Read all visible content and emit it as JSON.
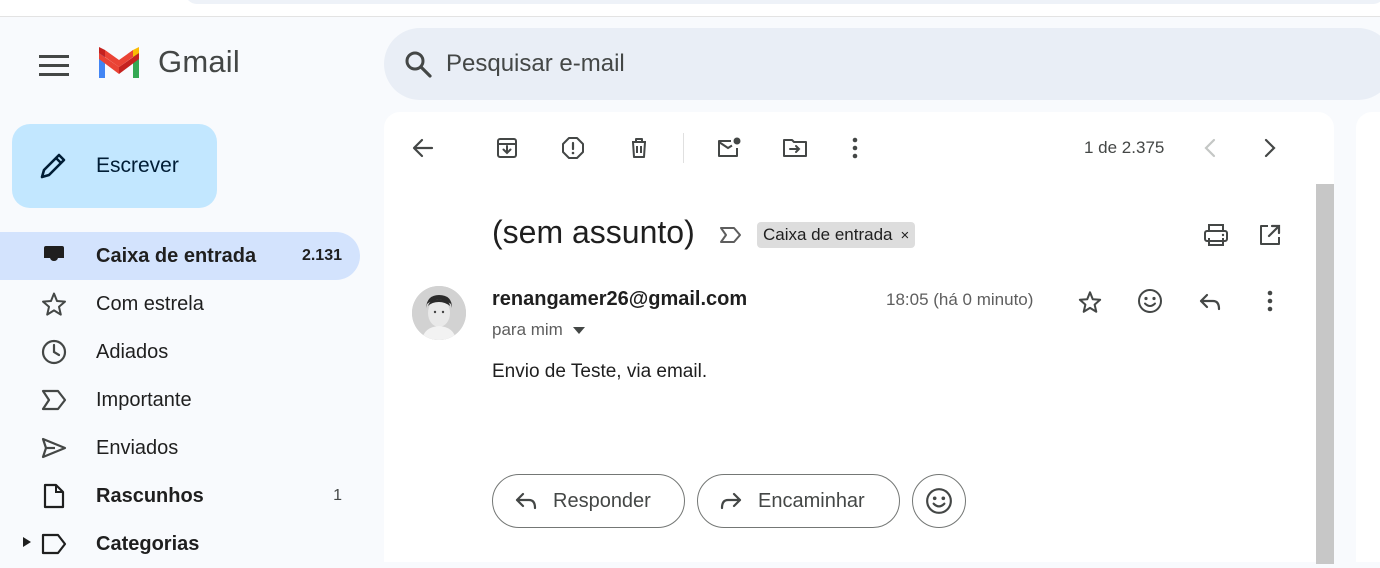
{
  "app": {
    "name": "Gmail"
  },
  "search": {
    "placeholder": "Pesquisar e-mail"
  },
  "compose": {
    "label": "Escrever"
  },
  "sidebar": {
    "items": [
      {
        "label": "Caixa de entrada",
        "count": "2.131",
        "icon": "inbox-icon",
        "active": true
      },
      {
        "label": "Com estrela",
        "count": "",
        "icon": "star-icon"
      },
      {
        "label": "Adiados",
        "count": "",
        "icon": "clock-icon"
      },
      {
        "label": "Importante",
        "count": "",
        "icon": "important-icon"
      },
      {
        "label": "Enviados",
        "count": "",
        "icon": "send-icon"
      },
      {
        "label": "Rascunhos",
        "count": "1",
        "icon": "draft-icon",
        "bold": true
      },
      {
        "label": "Categorias",
        "count": "",
        "icon": "label-icon",
        "bold": true
      }
    ]
  },
  "toolbar": {
    "buttons": [
      "back-icon",
      "archive-icon",
      "spam-icon",
      "delete-icon",
      "mark-unread-icon",
      "move-to-icon",
      "more-icon"
    ],
    "pager": "1 de 2.375"
  },
  "email": {
    "subject": "(sem assunto)",
    "label_chip": "Caixa de entrada",
    "label_chip_close": "×",
    "sender": "renangamer26@gmail.com",
    "recipient": "para mim",
    "timestamp": "18:05 (há 0 minuto)",
    "body": "Envio de Teste, via email."
  },
  "actions": {
    "reply": "Responder",
    "forward": "Encaminhar"
  },
  "colors": {
    "compose_bg": "#c2e7ff",
    "active_nav_bg": "#d3e3fd",
    "search_bg": "#e9eef6",
    "page_bg": "#f8fafd"
  }
}
